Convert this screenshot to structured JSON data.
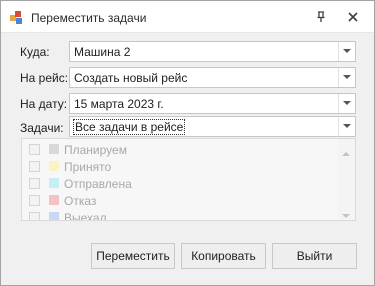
{
  "window": {
    "title": "Переместить задачи"
  },
  "form": {
    "destination": {
      "label": "Куда:",
      "value": "Машина 2"
    },
    "trip": {
      "label": "На рейс:",
      "value": "Создать новый рейс"
    },
    "date": {
      "label": "На дату:",
      "value": "15 марта 2023 г."
    },
    "tasks": {
      "label": "Задачи:",
      "value": "Все задачи в рейсе"
    }
  },
  "status_list": [
    {
      "label": "Планируем",
      "color": "#d9d9d9"
    },
    {
      "label": "Принято",
      "color": "#fbf3c7"
    },
    {
      "label": "Отправлена",
      "color": "#c6eef3"
    },
    {
      "label": "Отказ",
      "color": "#f3c2c2"
    },
    {
      "label": "Выехал",
      "color": "#c9d8f3"
    }
  ],
  "buttons": {
    "move": "Переместить",
    "copy": "Копировать",
    "exit": "Выйти"
  }
}
